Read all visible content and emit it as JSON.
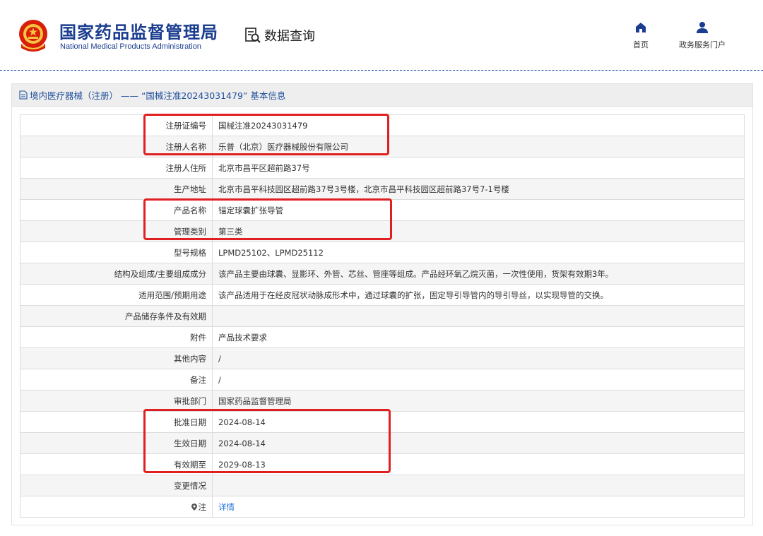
{
  "header": {
    "org_name_cn": "国家药品监督管理局",
    "org_name_en": "National Medical Products Administration",
    "query_label": "数据查询",
    "nav": [
      {
        "label": "首页",
        "icon": "home-icon"
      },
      {
        "label": "政务服务门户",
        "icon": "user-icon"
      }
    ]
  },
  "panel": {
    "title": "境内医疗器械（注册） —— “国械注准20243031479” 基本信息"
  },
  "rows": [
    {
      "key": "注册证编号",
      "value": "国械注准20243031479"
    },
    {
      "key": "注册人名称",
      "value": "乐普（北京）医疗器械股份有限公司"
    },
    {
      "key": "注册人住所",
      "value": "北京市昌平区超前路37号"
    },
    {
      "key": "生产地址",
      "value": "北京市昌平科技园区超前路37号3号楼，北京市昌平科技园区超前路37号7-1号楼"
    },
    {
      "key": "产品名称",
      "value": "锚定球囊扩张导管"
    },
    {
      "key": "管理类别",
      "value": "第三类"
    },
    {
      "key": "型号规格",
      "value": "LPMD25102、LPMD25112"
    },
    {
      "key": "结构及组成/主要组成成分",
      "value": "该产品主要由球囊、显影环、外管、芯丝、管座等组成。产品经环氧乙烷灭菌，一次性使用，货架有效期3年。"
    },
    {
      "key": "适用范围/预期用途",
      "value": "该产品适用于在经皮冠状动脉成形术中，通过球囊的扩张，固定导引导管内的导引导丝，以实现导管的交换。"
    },
    {
      "key": "产品储存条件及有效期",
      "value": ""
    },
    {
      "key": "附件",
      "value": "产品技术要求"
    },
    {
      "key": "其他内容",
      "value": "/"
    },
    {
      "key": "备注",
      "value": "/"
    },
    {
      "key": "审批部门",
      "value": "国家药品监督管理局"
    },
    {
      "key": "批准日期",
      "value": "2024-08-14"
    },
    {
      "key": "生效日期",
      "value": "2024-08-14"
    },
    {
      "key": "有效期至",
      "value": "2029-08-13"
    },
    {
      "key": "变更情况",
      "value": ""
    },
    {
      "key": "注",
      "value": "详情",
      "key_icon": "pin-icon"
    }
  ],
  "colors": {
    "brand_blue": "#1a3d8f",
    "link_blue": "#1a6ed8",
    "highlight_red": "#e02020"
  }
}
